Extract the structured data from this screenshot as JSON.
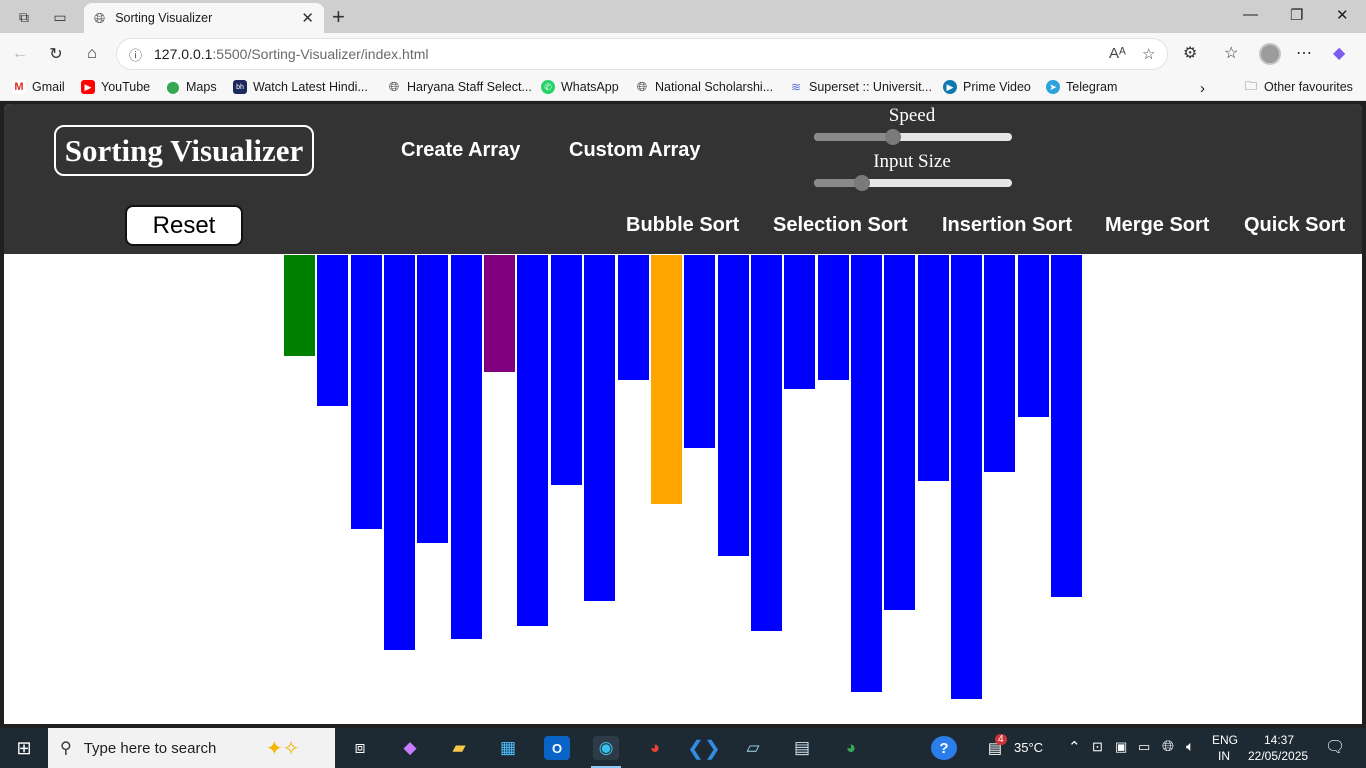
{
  "browser": {
    "tab_title": "Sorting Visualizer",
    "url_host": "127.0.0.1",
    "url_path": ":5500/Sorting-Visualizer/index.html",
    "bookmarks": [
      "Gmail",
      "YouTube",
      "Maps",
      "Watch Latest Hindi...",
      "Haryana Staff Select...",
      "WhatsApp",
      "National Scholarshi...",
      "Superset :: Universit...",
      "Prime Video",
      "Telegram"
    ],
    "other_favourites": "Other favourites"
  },
  "app": {
    "brand": "Sorting Visualizer",
    "nav": {
      "create_array": "Create Array",
      "custom_array": "Custom Array"
    },
    "speed_label": "Speed",
    "speed_value": 0.4,
    "input_size_label": "Input Size",
    "input_size_value": 0.24,
    "reset_label": "Reset",
    "algorithms": [
      "Bubble Sort",
      "Selection Sort",
      "Insertion Sort",
      "Merge Sort",
      "Quick Sort"
    ],
    "colors": {
      "default": "#0000ff",
      "sorted": "#008000",
      "compare": "#800080",
      "swap": "#ffa500",
      "header": "#333333"
    },
    "array_bars": [
      {
        "value": 101,
        "state": "sorted"
      },
      {
        "value": 151,
        "state": "default"
      },
      {
        "value": 274,
        "state": "default"
      },
      {
        "value": 395,
        "state": "default"
      },
      {
        "value": 288,
        "state": "default"
      },
      {
        "value": 384,
        "state": "default"
      },
      {
        "value": 117,
        "state": "compare"
      },
      {
        "value": 371,
        "state": "default"
      },
      {
        "value": 230,
        "state": "default"
      },
      {
        "value": 346,
        "state": "default"
      },
      {
        "value": 125,
        "state": "default"
      },
      {
        "value": 249,
        "state": "swap"
      },
      {
        "value": 193,
        "state": "default"
      },
      {
        "value": 301,
        "state": "default"
      },
      {
        "value": 376,
        "state": "default"
      },
      {
        "value": 134,
        "state": "default"
      },
      {
        "value": 125,
        "state": "default"
      },
      {
        "value": 437,
        "state": "default"
      },
      {
        "value": 355,
        "state": "default"
      },
      {
        "value": 226,
        "state": "default"
      },
      {
        "value": 444,
        "state": "default"
      },
      {
        "value": 217,
        "state": "default"
      },
      {
        "value": 162,
        "state": "default"
      },
      {
        "value": 342,
        "state": "default"
      }
    ]
  },
  "taskbar": {
    "search_placeholder": "Type here to search",
    "weather": "35°C",
    "lang_top": "ENG",
    "lang_bottom": "IN",
    "time": "14:37",
    "date": "22/05/2025",
    "notif_count": "4"
  }
}
